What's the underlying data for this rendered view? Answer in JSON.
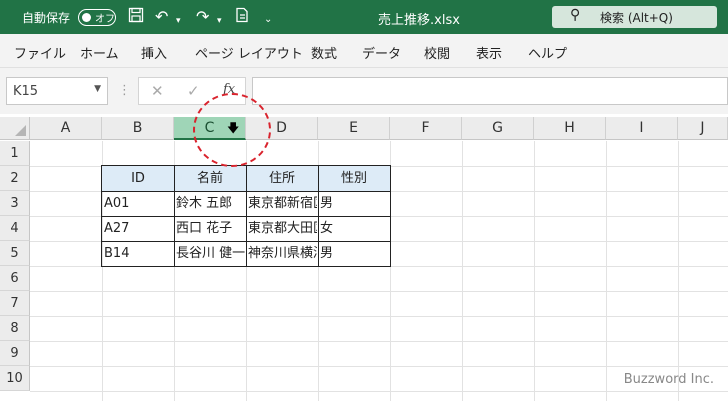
{
  "titlebar": {
    "autosave_label": "自動保存",
    "toggle_label": "オフ",
    "filename": "売上推移.xlsx",
    "search_placeholder": "検索 (Alt+Q)"
  },
  "ribbon_tabs": [
    "ファイル",
    "ホーム",
    "挿入",
    "ページ レイアウト",
    "数式",
    "データ",
    "校閲",
    "表示",
    "ヘルプ"
  ],
  "formula_bar": {
    "name_box": "K15",
    "cancel": "✕",
    "enter": "✓",
    "fx": "fx",
    "content": ""
  },
  "columns": [
    "A",
    "B",
    "C",
    "D",
    "E",
    "F",
    "G",
    "H",
    "I",
    "J"
  ],
  "selected_column": "C",
  "rows": [
    "1",
    "2",
    "3",
    "4",
    "5",
    "6",
    "7",
    "8",
    "9",
    "10"
  ],
  "table": {
    "headers": [
      "ID",
      "名前",
      "住所",
      "性別"
    ],
    "rows": [
      [
        "A01",
        "鈴木 五郎",
        "東京都新宿区",
        "男"
      ],
      [
        "A27",
        "西口 花子",
        "東京都大田区",
        "女"
      ],
      [
        "B14",
        "長谷川 健一",
        "神奈川県横浜市",
        "男"
      ]
    ]
  },
  "colors": {
    "accent": "#217346",
    "header_fill": "#ddebf7",
    "annotation": "#d9232d"
  },
  "watermark": "Buzzword Inc."
}
